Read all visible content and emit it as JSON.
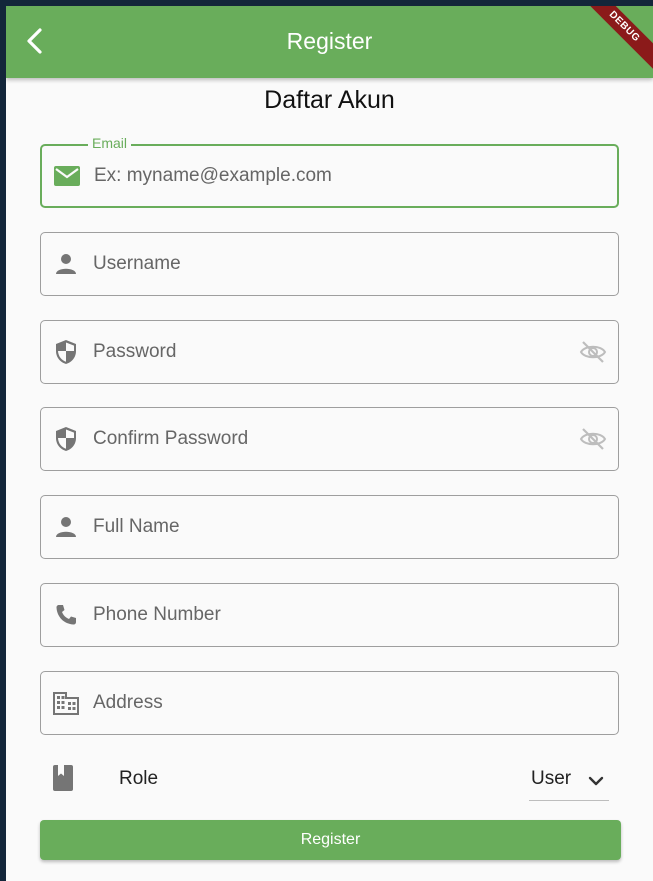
{
  "appbar": {
    "title": "Register",
    "debug_banner": "DEBUG"
  },
  "heading": "Daftar Akun",
  "fields": {
    "email": {
      "label": "Email",
      "placeholder": "Ex: myname@example.com",
      "icon": "mail-icon",
      "focused": true
    },
    "username": {
      "placeholder": "Username",
      "icon": "person-icon"
    },
    "password": {
      "placeholder": "Password",
      "icon": "shield-icon",
      "toggle_icon": "visibility-off-icon"
    },
    "confirm_password": {
      "placeholder": "Confirm Password",
      "icon": "shield-icon",
      "toggle_icon": "visibility-off-icon"
    },
    "full_name": {
      "placeholder": "Full Name",
      "icon": "person-icon"
    },
    "phone": {
      "placeholder": "Phone Number",
      "icon": "phone-icon"
    },
    "address": {
      "placeholder": "Address",
      "icon": "building-icon"
    }
  },
  "role": {
    "label": "Role",
    "value": "User",
    "icon": "bookmark-book-icon"
  },
  "submit_label": "Register",
  "colors": {
    "primary": "#69ad5b",
    "debug": "#8b1a1a",
    "border": "#9e9e9e",
    "icon": "#757575"
  }
}
